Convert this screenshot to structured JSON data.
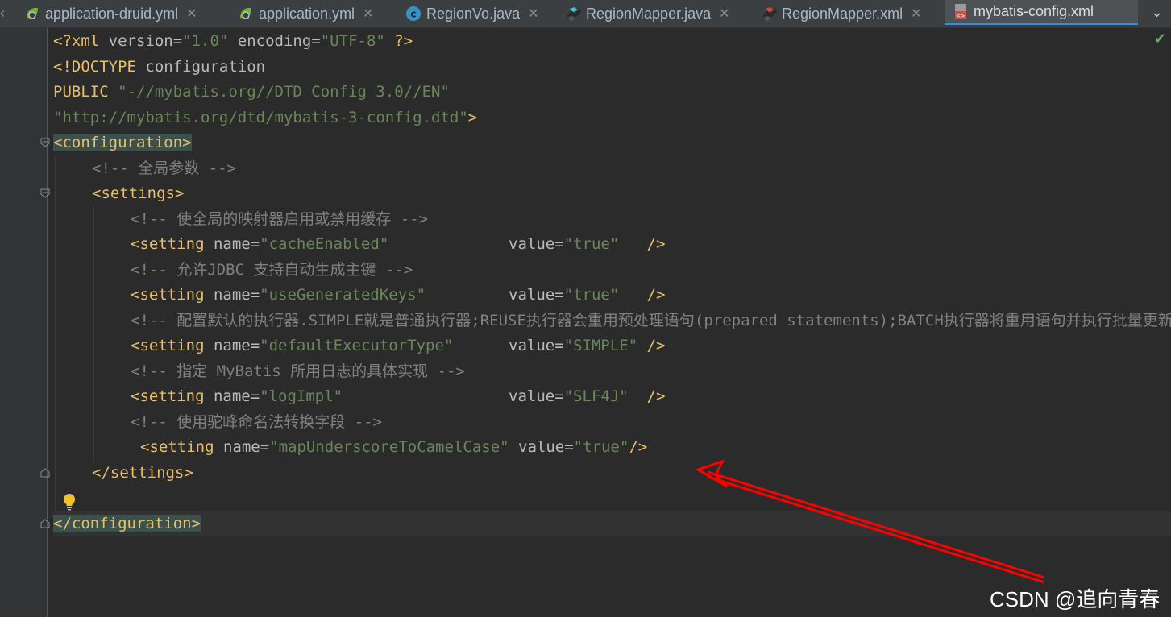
{
  "tabs": [
    {
      "name": "application-druid.yml",
      "icon": "spring-config-icon"
    },
    {
      "name": "application.yml",
      "icon": "spring-config-icon"
    },
    {
      "name": "RegionVo.java",
      "icon": "java-class-icon"
    },
    {
      "name": "RegionMapper.java",
      "icon": "mybatis-mapper-java-icon"
    },
    {
      "name": "RegionMapper.xml",
      "icon": "mybatis-mapper-xml-icon"
    },
    {
      "name": "mybatis-config.xml",
      "icon": "xml-file-icon",
      "active": true
    }
  ],
  "code": {
    "l1": {
      "decl": "<?xml",
      "v_attr": " version=",
      "v_val": "\"1.0\"",
      "e_attr": " encoding=",
      "e_val": "\"UTF-8\"",
      "end": " ?>"
    },
    "l2": {
      "doctype": "<!DOCTYPE",
      "rest": " configuration"
    },
    "l3": {
      "kw": "PUBLIC",
      "val": " \"-//mybatis.org//DTD Config 3.0//EN\""
    },
    "l4": {
      "val": "\"http://mybatis.org/dtd/mybatis-3-config.dtd\"",
      "end": ">"
    },
    "l5": {
      "tag": "<configuration>"
    },
    "l6": {
      "comment": "<!-- 全局参数 -->"
    },
    "l7": {
      "tag": "<settings>"
    },
    "l8": {
      "comment": "<!-- 使全局的映射器启用或禁用缓存 -->"
    },
    "l9": {
      "open": "<setting",
      "name_attr": " name=",
      "name_val": "\"cacheEnabled\"",
      "pad": "             ",
      "value_attr": "value=",
      "value_val": "\"true\"",
      "end": "   />"
    },
    "l10": {
      "comment": "<!-- 允许JDBC 支持自动生成主键 -->"
    },
    "l11": {
      "open": "<setting",
      "name_attr": " name=",
      "name_val": "\"useGeneratedKeys\"",
      "pad": "         ",
      "value_attr": "value=",
      "value_val": "\"true\"",
      "end": "   />"
    },
    "l12": {
      "comment": "<!-- 配置默认的执行器.SIMPLE就是普通执行器;REUSE执行器会重用预处理语句(prepared statements);BATCH执行器将重用语句并执行批量更新 -->"
    },
    "l13": {
      "open": "<setting",
      "name_attr": " name=",
      "name_val": "\"defaultExecutorType\"",
      "pad": "      ",
      "value_attr": "value=",
      "value_val": "\"SIMPLE\"",
      "end": " />"
    },
    "l14": {
      "comment": "<!-- 指定 MyBatis 所用日志的具体实现 -->"
    },
    "l15": {
      "open": "<setting",
      "name_attr": " name=",
      "name_val": "\"logImpl\"",
      "pad": "                  ",
      "value_attr": "value=",
      "value_val": "\"SLF4J\"",
      "end": "  />"
    },
    "l16": {
      "comment": "<!-- 使用驼峰命名法转换字段 -->"
    },
    "l17": {
      "open": "<setting",
      "name_attr": " name=",
      "name_val": "\"mapUnderscoreToCamelCase\"",
      "pad": " ",
      "value_attr": "value=",
      "value_val": "\"true\"",
      "end": "/>"
    },
    "l18": {
      "tag": "</settings>"
    },
    "l20": {
      "tag": "</configuration>"
    }
  },
  "watermark": "CSDN @追向青春",
  "status_icon": "inspection-ok-check-icon",
  "colors": {
    "tag": "#e8bf6a",
    "value": "#6a8759",
    "comment": "#808080",
    "annotation_arrow": "#ff0000"
  }
}
